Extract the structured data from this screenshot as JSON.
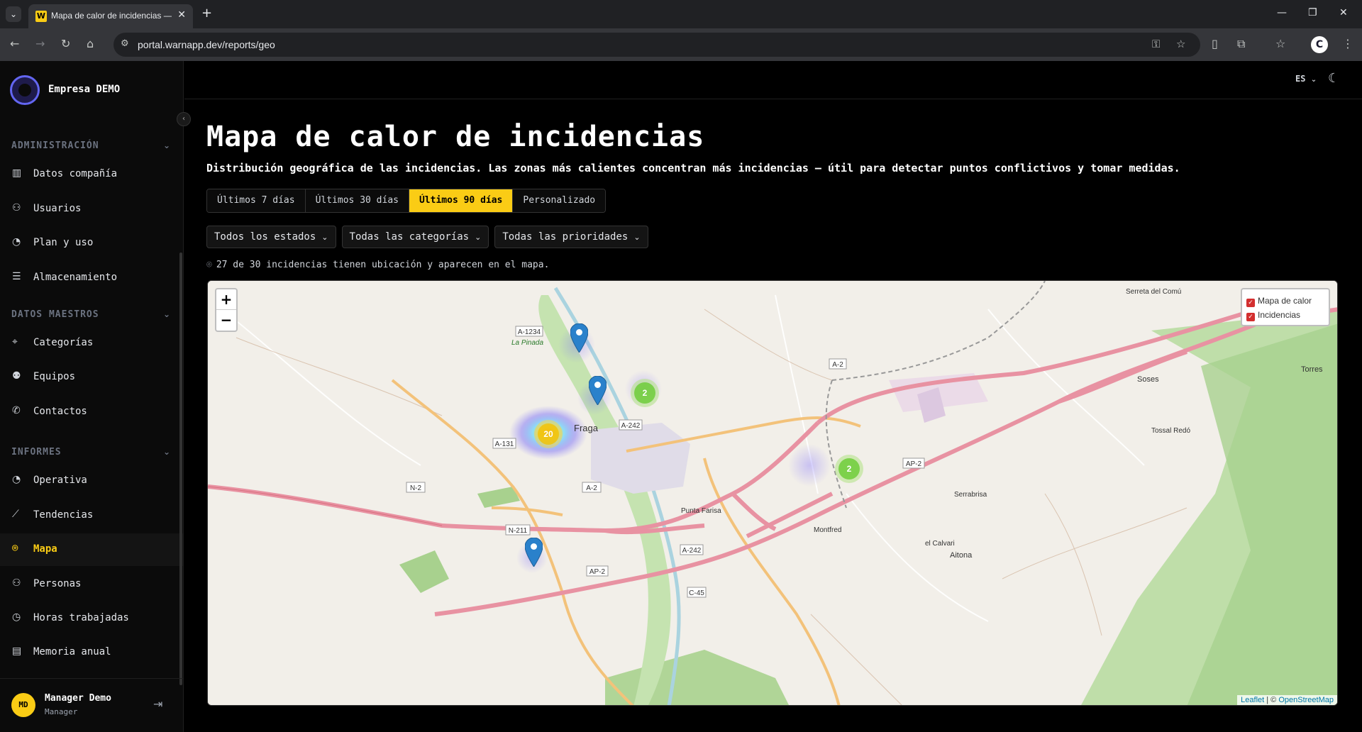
{
  "browser": {
    "tab_title": "Mapa de calor de incidencias —",
    "url": "portal.warnapp.dev/reports/geo",
    "favicon_letter": "W",
    "profile_letter": "C"
  },
  "sidebar": {
    "company": "Empresa DEMO",
    "sections": [
      {
        "title": "ADMINISTRACIÓN",
        "items": [
          {
            "label": "Datos compañía",
            "icon": "building-icon"
          },
          {
            "label": "Usuarios",
            "icon": "users-icon"
          },
          {
            "label": "Plan y uso",
            "icon": "gauge-icon"
          },
          {
            "label": "Almacenamiento",
            "icon": "storage-icon"
          }
        ]
      },
      {
        "title": "DATOS MAESTROS",
        "items": [
          {
            "label": "Categorías",
            "icon": "tag-icon"
          },
          {
            "label": "Equipos",
            "icon": "team-icon"
          },
          {
            "label": "Contactos",
            "icon": "phone-icon"
          }
        ]
      },
      {
        "title": "INFORMES",
        "items": [
          {
            "label": "Operativa",
            "icon": "gauge-icon"
          },
          {
            "label": "Tendencias",
            "icon": "trend-icon"
          },
          {
            "label": "Mapa",
            "icon": "map-pin-icon",
            "active": true
          },
          {
            "label": "Personas",
            "icon": "users-icon"
          },
          {
            "label": "Horas trabajadas",
            "icon": "clock-icon"
          },
          {
            "label": "Memoria anual",
            "icon": "document-icon"
          }
        ]
      }
    ],
    "user": {
      "initials": "MD",
      "name": "Manager Demo",
      "role": "Manager"
    }
  },
  "topbar": {
    "language": "ES"
  },
  "page": {
    "title": "Mapa de calor de incidencias",
    "subtitle": "Distribución geográfica de las incidencias. Las zonas más calientes concentran más incidencias — útil para detectar puntos conflictivos y tomar medidas.",
    "ranges": [
      {
        "label": "Últimos 7 días"
      },
      {
        "label": "Últimos 30 días"
      },
      {
        "label": "Últimos 90 días",
        "active": true
      },
      {
        "label": "Personalizado"
      }
    ],
    "filters": {
      "status": "Todos los estados",
      "category": "Todas las categorías",
      "priority": "Todas las prioridades"
    },
    "info": "27 de 30 incidencias tienen ubicación y aparecen en el mapa."
  },
  "map": {
    "layers": [
      "Mapa de calor",
      "Incidencias"
    ],
    "clusters": [
      "20",
      "2",
      "2"
    ],
    "labels": {
      "fraga": "Fraga",
      "la_pinada": "La Pinada",
      "soses": "Soses",
      "aitona": "Aitona",
      "torres": "Torres",
      "punta_farisa": "Punta Farisa",
      "serrabrisa": "Serrabrisa",
      "montfred": "Montfred",
      "el_calvari": "el Calvari",
      "tossal_redo": "Tossal Redó",
      "serreta": "Serreta del Comú",
      "a1234": "A-1234",
      "a2": "A-2",
      "a242": "A-242",
      "a131": "A-131",
      "n2": "N-2",
      "n211": "N-211",
      "ap2": "AP-2",
      "c45": "C-45"
    },
    "attribution_leaflet": "Leaflet",
    "attribution_sep": " | © ",
    "attribution_osm": "OpenStreetMap"
  }
}
